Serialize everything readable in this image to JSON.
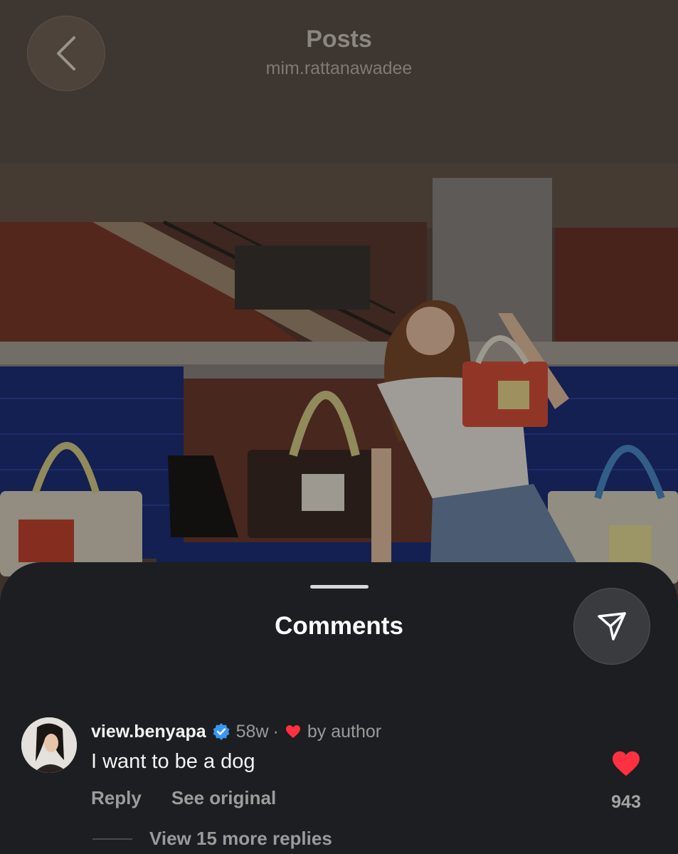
{
  "header": {
    "title": "Posts",
    "username": "mim.rattanawadee",
    "back_icon": "chevron-left-icon"
  },
  "sheet": {
    "title": "Comments",
    "share_icon": "send-icon"
  },
  "comment": {
    "username": "view.benyapa",
    "verified": true,
    "time": "58w",
    "separator": "·",
    "liked_by_author_label": "by author",
    "text": "I want to be a dog",
    "reply_label": "Reply",
    "see_original_label": "See original",
    "like_count": "943",
    "liked": true,
    "view_replies_label": "View 15 more replies"
  },
  "colors": {
    "sheet_bg": "#1c1e21",
    "heart": "#ff3040",
    "verified": "#3897f0"
  }
}
